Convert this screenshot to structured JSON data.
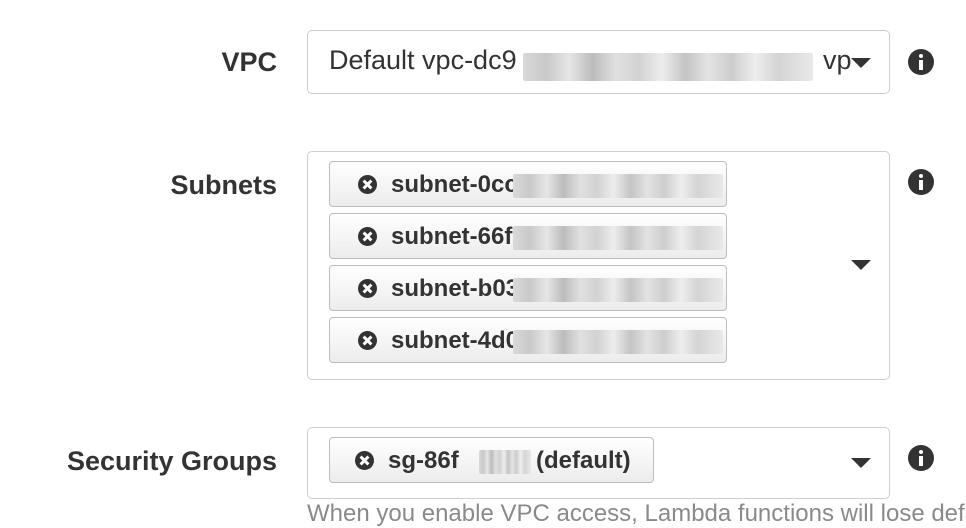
{
  "vpc": {
    "label": "VPC",
    "value_prefix": "Default vpc-dc9",
    "value_suffix": "vp"
  },
  "subnets": {
    "label": "Subnets",
    "items": [
      {
        "label": "subnet-0cc"
      },
      {
        "label": "subnet-66f"
      },
      {
        "label": "subnet-b03"
      },
      {
        "label": "subnet-4d0"
      }
    ]
  },
  "security_groups": {
    "label": "Security Groups",
    "item_prefix": "sg-86f",
    "item_suffix": "(default)"
  },
  "footnote": "When you enable VPC access, Lambda functions will lose default"
}
